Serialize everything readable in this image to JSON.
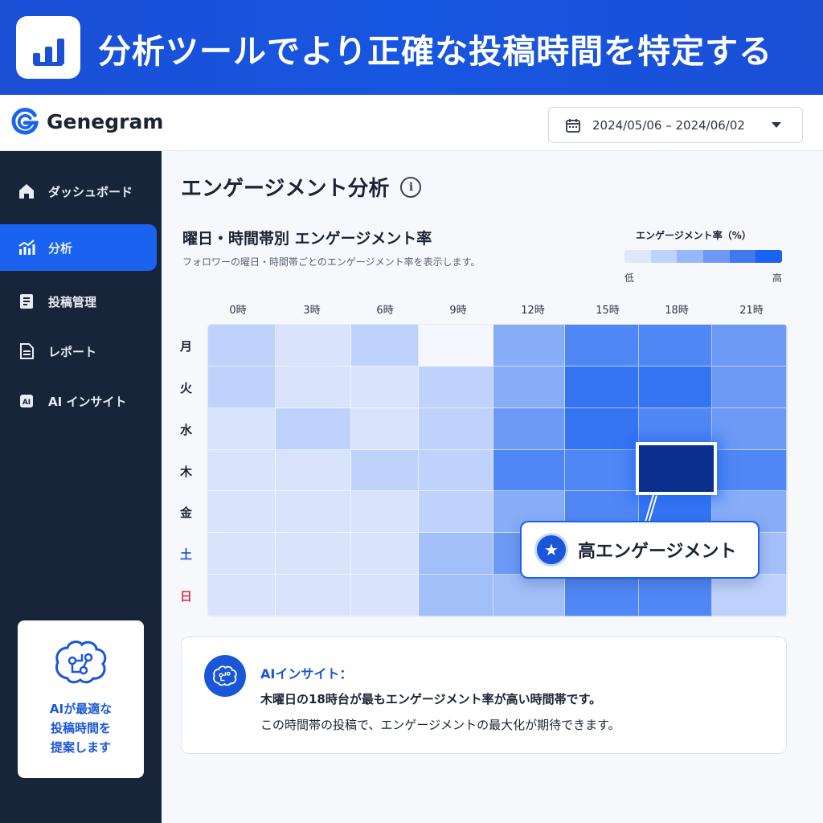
{
  "banner": {
    "title": "分析ツールでより正確な投稿時間を特定する",
    "icon": "bar-chart-icon"
  },
  "header": {
    "brand": "Genegram",
    "date_range": "2024/05/06 – 2024/06/02"
  },
  "sidebar": {
    "items": [
      {
        "label": "ダッシュボード",
        "icon": "home-icon",
        "active": false
      },
      {
        "label": "分析",
        "icon": "analytics-icon",
        "active": true
      },
      {
        "label": "投稿管理",
        "icon": "document-icon",
        "active": false
      },
      {
        "label": "レポート",
        "icon": "report-icon",
        "active": false
      },
      {
        "label": "AI インサイト",
        "icon": "ai-chip-icon",
        "active": false
      }
    ],
    "ai_card": {
      "lines": [
        "AIが最適な",
        "投稿時間を",
        "提案します"
      ],
      "icon": "brain-icon"
    }
  },
  "main": {
    "page_title": "エンゲージメント分析",
    "chart_title": "曜日・時間帯別 エンゲージメント率",
    "chart_subtitle": "フォロワーの曜日・時間帯ごとのエンゲージメント率を表示します。",
    "legend": {
      "title": "エンゲージメント率（%）",
      "low": "低",
      "high": "高"
    },
    "callout": "高エンゲージメント",
    "insight": {
      "title": "AIインサイト：",
      "line1": "木曜日の18時台が最もエンゲージメント率が高い時間帯です。",
      "line2": "この時間帯の投稿で、エンゲージメントの最大化が期待できます。"
    }
  },
  "colors": {
    "accent": "#1a62f0",
    "sidebar": "#17243a",
    "banner": "#1a4fd6",
    "peak": "#0a2f8f",
    "saturday": "#1a56d8",
    "sunday": "#e0314b"
  },
  "chart_data": {
    "type": "heatmap",
    "x": [
      "0時",
      "3時",
      "6時",
      "9時",
      "12時",
      "15時",
      "18時",
      "21時"
    ],
    "y": [
      "月",
      "火",
      "水",
      "木",
      "金",
      "土",
      "日"
    ],
    "values": [
      [
        2,
        1,
        2,
        0,
        4,
        6,
        6,
        5
      ],
      [
        2,
        1,
        1,
        2,
        4,
        7,
        7,
        5
      ],
      [
        1,
        2,
        1,
        2,
        5,
        7,
        6,
        5
      ],
      [
        1,
        1,
        2,
        2,
        6,
        6,
        10,
        6
      ],
      [
        1,
        1,
        1,
        2,
        4,
        6,
        7,
        4
      ],
      [
        1,
        1,
        1,
        3,
        5,
        6,
        6,
        3
      ],
      [
        1,
        1,
        1,
        3,
        3,
        6,
        6,
        2
      ]
    ],
    "scale": [
      "低",
      "高"
    ],
    "highlight": {
      "day": "木",
      "time": "18時",
      "label": "高エンゲージメント"
    }
  }
}
